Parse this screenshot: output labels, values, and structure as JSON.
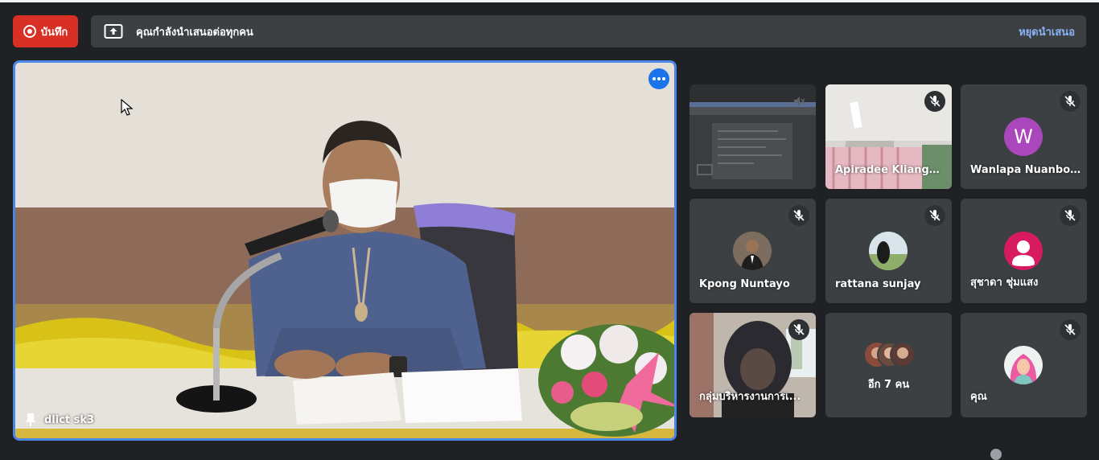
{
  "record": {
    "label": "บันทึก"
  },
  "presentation": {
    "message": "คุณกำลังนำเสนอต่อทุกคน",
    "stop_label": "หยุดนำเสนอ"
  },
  "main_speaker": {
    "name": "dlict sk3"
  },
  "participants": [
    {
      "name": "",
      "type": "screen-share"
    },
    {
      "name": "Apiradee Kliangk...",
      "type": "video"
    },
    {
      "name": "Wanlapa Nuanboon",
      "type": "avatar",
      "initial": "W",
      "color": "#ab47bc"
    },
    {
      "name": "Kpong Nuntayo",
      "type": "photo"
    },
    {
      "name": "rattana sunjay",
      "type": "photo"
    },
    {
      "name": "สุชาดา ชุ่มแสง",
      "type": "avatar",
      "color": "#d81b60"
    },
    {
      "name": "กลุ่มบริหารงานการเ...",
      "type": "video"
    },
    {
      "name": "",
      "type": "more",
      "more_label": "อีก 7 คน"
    },
    {
      "name": "คุณ",
      "type": "photo"
    }
  ],
  "colors": {
    "background": "#202124",
    "tile": "#3c4043",
    "accent_blue": "#1a73e8",
    "record_red": "#d93025",
    "link_blue": "#8ab4f8"
  },
  "icons": [
    "record-icon",
    "present-screen-icon",
    "more-options-icon",
    "mic-off-icon",
    "pin-icon"
  ]
}
